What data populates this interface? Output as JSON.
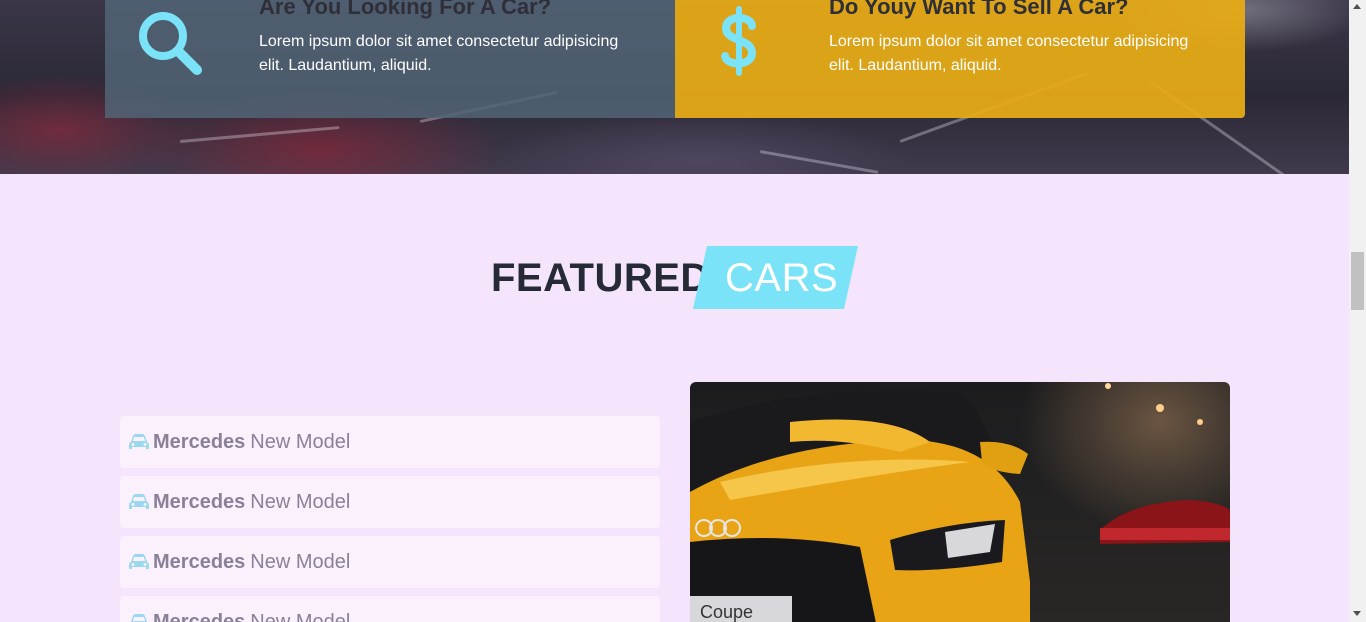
{
  "services": [
    {
      "title": "Are You Looking For A Car?",
      "text": "Lorem ipsum dolor sit amet consectetur adipisicing elit. Laudantium, aliquid.",
      "icon": "search-icon"
    },
    {
      "title": "Do Youy Want To Sell A Car?",
      "text": "Lorem ipsum dolor sit amet consectetur adipisicing elit. Laudantium, aliquid.",
      "icon": "dollar-icon"
    }
  ],
  "featured": {
    "word1": "FEATURED",
    "word2": "CARS"
  },
  "cars": [
    {
      "brand": "Mercedes",
      "model": "New Model",
      "icon": "car-icon"
    },
    {
      "brand": "Mercedes",
      "model": "New Model",
      "icon": "car-icon"
    },
    {
      "brand": "Mercedes",
      "model": "New Model",
      "icon": "car-icon"
    },
    {
      "brand": "Mercedes",
      "model": "New Model",
      "icon": "car-icon"
    }
  ],
  "photo": {
    "plate_text": "Coupe"
  },
  "colors": {
    "accent": "#7ae3f7",
    "yellow": "#e8ac14",
    "background": "#f5e5fc",
    "dark": "#262a36"
  }
}
